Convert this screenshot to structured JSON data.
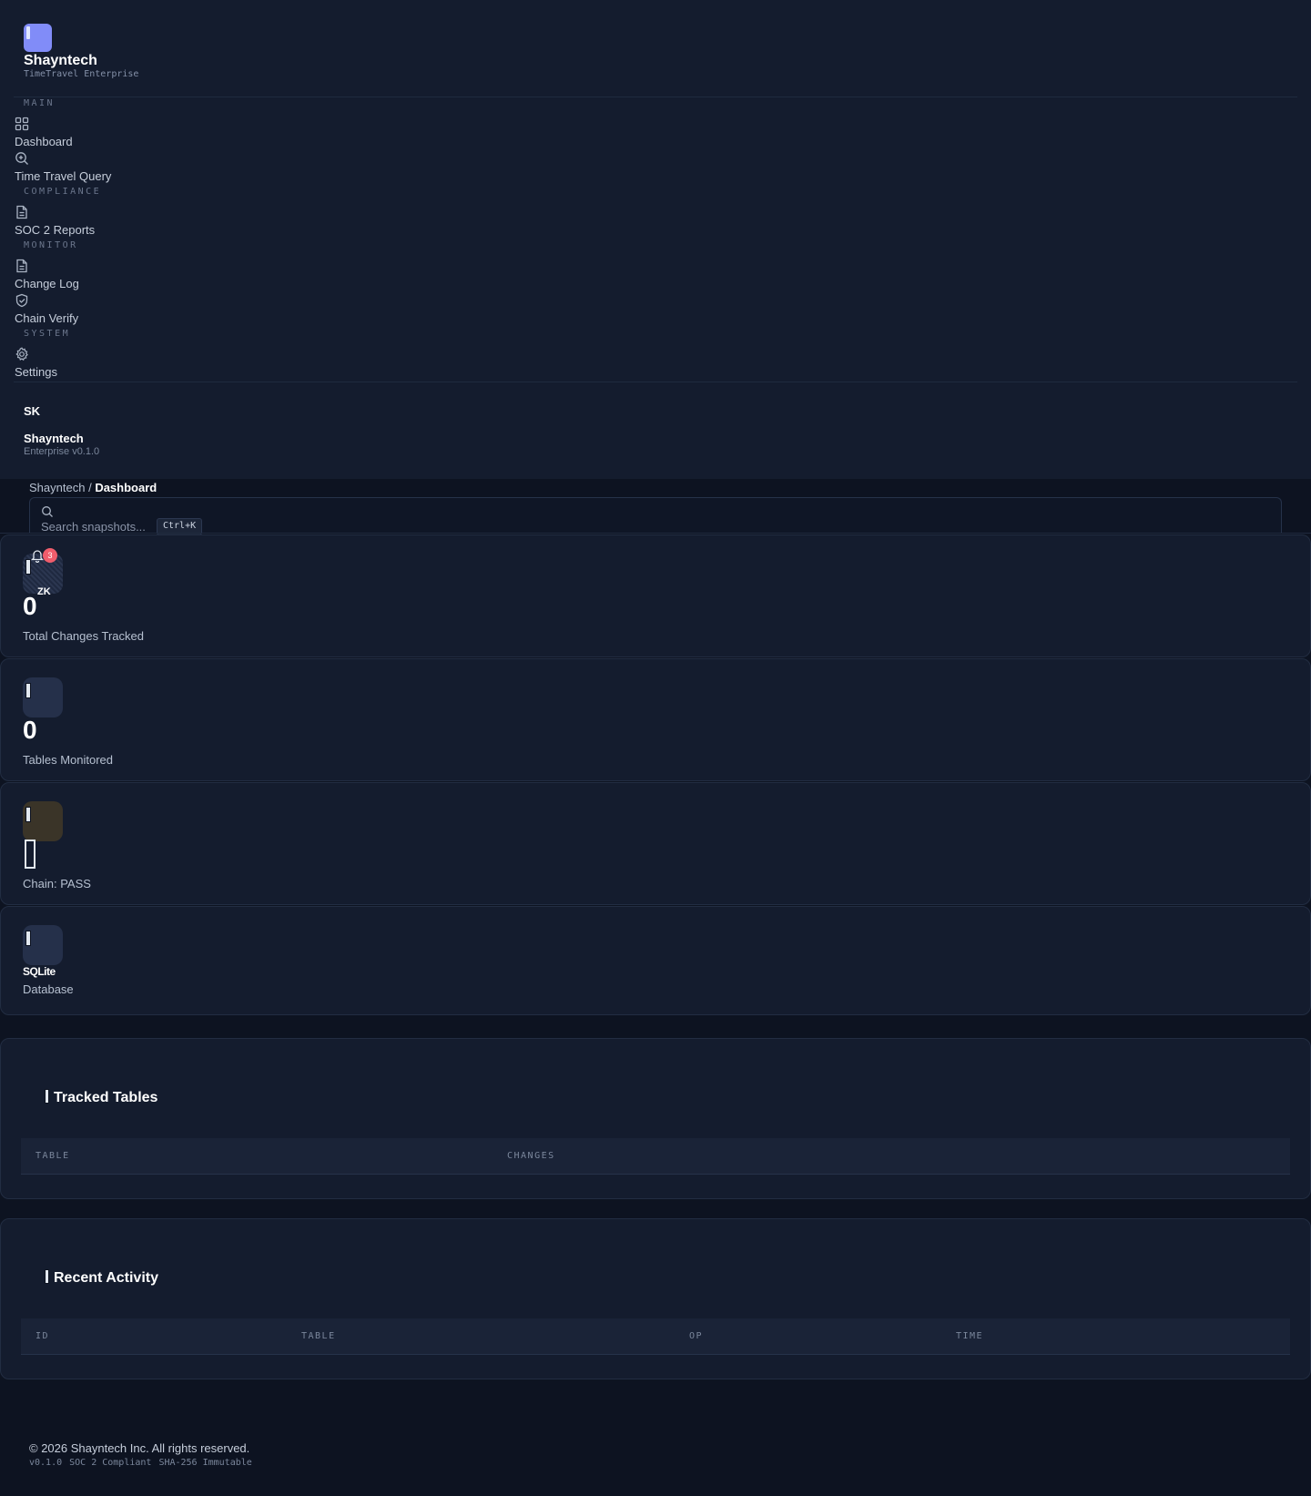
{
  "brand": {
    "name": "Shayntech",
    "subtitle": "TimeTravel Enterprise"
  },
  "nav": {
    "sections": [
      {
        "label": "MAIN",
        "items": [
          {
            "label": "Dashboard",
            "icon": "grid-icon"
          },
          {
            "label": "Time Travel Query",
            "icon": "zoom-icon"
          }
        ]
      },
      {
        "label": "COMPLIANCE",
        "items": [
          {
            "label": "SOC 2 Reports",
            "icon": "document-icon"
          }
        ]
      },
      {
        "label": "MONITOR",
        "items": [
          {
            "label": "Change Log",
            "icon": "document-icon"
          },
          {
            "label": "Chain Verify",
            "icon": "shield-check-icon"
          }
        ]
      },
      {
        "label": "SYSTEM",
        "items": [
          {
            "label": "Settings",
            "icon": "gear-icon"
          }
        ]
      }
    ]
  },
  "user": {
    "initials": "SK",
    "name": "Shayntech",
    "version": "Enterprise v0.1.0"
  },
  "header": {
    "breadcrumb_root": "Shayntech",
    "breadcrumb_sep": "/",
    "breadcrumb_current": "Dashboard",
    "search_placeholder": "Search snapshots...",
    "search_shortcut": "Ctrl+K",
    "notification_count": "3",
    "avatar_initials": "ZK"
  },
  "stats": [
    {
      "value": "0",
      "label": "Total Changes Tracked"
    },
    {
      "value": "0",
      "label": "Tables Monitored"
    },
    {
      "value": "",
      "label": "Chain: PASS"
    },
    {
      "value": "SQLite",
      "label": "Database"
    }
  ],
  "tracked_tables": {
    "title": "Tracked Tables",
    "columns": [
      "TABLE",
      "CHANGES"
    ]
  },
  "recent_activity": {
    "title": "Recent Activity",
    "columns": [
      "ID",
      "TABLE",
      "OP",
      "TIME"
    ]
  },
  "footer": {
    "copyright": "© 2026 Shayntech Inc. All rights reserved.",
    "meta": [
      "v0.1.0",
      "SOC 2 Compliant",
      "SHA-256 Immutable"
    ]
  },
  "colors": {
    "accent": "#818cf8",
    "background": "#0d1321",
    "surface": "#141c2e",
    "badge": "#f05d6c"
  }
}
